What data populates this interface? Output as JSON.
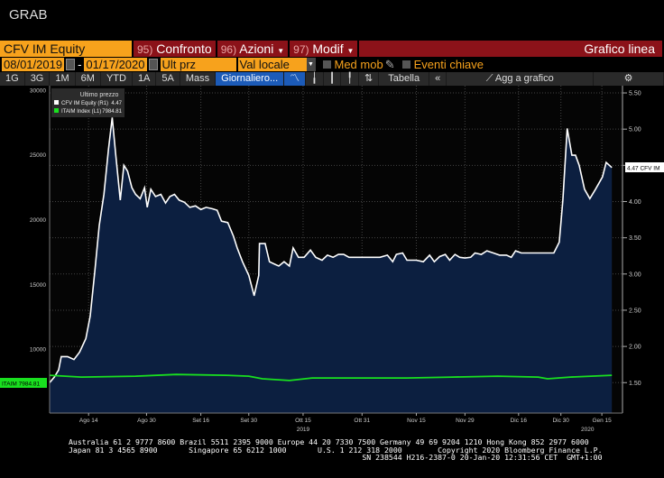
{
  "title": "GRAB",
  "toolbar1": {
    "ticker": "CFV IM Equity",
    "compare_num": "95)",
    "compare": "Confronto",
    "actions_num": "96)",
    "actions": "Azioni",
    "edit_num": "97)",
    "edit": "Modif",
    "chart_type": "Grafico linea"
  },
  "toolbar2": {
    "start_date": "08/01/2019",
    "dash": "-",
    "end_date": "01/17/2020",
    "price_field": "Ult prz",
    "currency": "Val locale",
    "moving_avg": "Med mob",
    "key_events": "Eventi chiave"
  },
  "toolbar3": {
    "periods": [
      "1G",
      "3G",
      "1M",
      "6M",
      "YTD",
      "1A",
      "5A",
      "Mass"
    ],
    "frequency": "Giornaliero...",
    "table": "Tabella",
    "add_to_chart": "Agg a grafico"
  },
  "legend": {
    "title": "Ultimo prezzo",
    "items": [
      {
        "label": "CFV IM Equity",
        "axis": "(R1)",
        "value": "4.47",
        "color": "#ffffff"
      },
      {
        "label": "ITAIM Index",
        "axis": "(L1)",
        "value": "7984.81",
        "color": "#00e000"
      }
    ]
  },
  "last_labels": {
    "cfv": "4.47 CFV IM",
    "itaim": "ITAIM 7984.81"
  },
  "chart_data": {
    "type": "line",
    "x_unit": "days since 2019-08-01",
    "x_range": [
      0,
      172
    ],
    "left_axis": {
      "ticks": [
        "30000",
        "25000",
        "20000",
        "15000",
        "10000"
      ],
      "tick_values": [
        30000,
        25000,
        20000,
        15000,
        10000
      ],
      "ylim": [
        5070,
        30340
      ]
    },
    "right_axis": {
      "ticks": [
        "5.50",
        "5.00",
        "4.50",
        "4.00",
        "3.50",
        "3.00",
        "2.50",
        "2.00",
        "1.50"
      ],
      "tick_values": [
        5.5,
        5.0,
        4.5,
        4.0,
        3.5,
        3.0,
        2.5,
        2.0,
        1.5
      ],
      "ylim": [
        1.08,
        5.6
      ]
    },
    "x_ticks": [
      {
        "label": "Ago 14",
        "day": 11.7
      },
      {
        "label": "Ago 30",
        "day": 29.1
      },
      {
        "label": "Set 16",
        "day": 45.4
      },
      {
        "label": "Set 30",
        "day": 59.8
      },
      {
        "label": "Ott 15",
        "day": 76.1
      },
      {
        "label": "Ott 31",
        "day": 93.8
      },
      {
        "label": "Nov 15",
        "day": 110.1
      },
      {
        "label": "Nov 29",
        "day": 124.7
      },
      {
        "label": "Dic 16",
        "day": 140.8
      },
      {
        "label": "Dic 30",
        "day": 153.5
      },
      {
        "label": "Gen 15",
        "day": 165.8
      }
    ],
    "year_labels": [
      {
        "label": "2019",
        "day": 76.1
      },
      {
        "label": "2020",
        "day": 161.5
      }
    ],
    "series": [
      {
        "name": "CFV IM Equity",
        "axis": "right",
        "color": "#ffffff",
        "x": [
          0,
          1.4,
          2.7,
          3.5,
          5.4,
          7.3,
          9.0,
          10.9,
          12.2,
          13.6,
          14.9,
          16.3,
          17.7,
          18.8,
          19.8,
          21.2,
          22.3,
          23.4,
          24.7,
          25.8,
          27.2,
          28.5,
          29.3,
          30.4,
          31.8,
          33.4,
          34.8,
          36.1,
          37.5,
          38.9,
          40.5,
          42.1,
          43.8,
          45.4,
          47.0,
          48.9,
          50.3,
          51.6,
          53.5,
          55.2,
          56.3,
          57.9,
          59.8,
          61.4,
          62.8,
          63.0,
          64.7,
          66.0,
          67.4,
          68.8,
          70.4,
          72.0,
          73.1,
          74.7,
          76.4,
          78.3,
          79.9,
          81.8,
          83.4,
          85.1,
          86.7,
          88.3,
          89.9,
          91.6,
          93.8,
          96.5,
          99.2,
          101.4,
          103.0,
          104.1,
          106.0,
          107.3,
          110.1,
          112.2,
          114.1,
          115.5,
          117.1,
          118.8,
          120.1,
          121.7,
          123.1,
          124.7,
          126.4,
          127.7,
          129.6,
          131.3,
          133.2,
          135.1,
          137.2,
          138.6,
          139.9,
          141.6,
          143.2,
          145.4,
          148.1,
          151.4,
          153.0,
          154.1,
          155.4,
          156.8,
          157.9,
          159.0,
          160.6,
          162.2,
          163.9,
          166.0,
          167.1,
          168.8
        ],
        "values": [
          1.5,
          1.575,
          1.675,
          1.86,
          1.86,
          1.82,
          1.92,
          2.11,
          2.42,
          3.05,
          3.67,
          4.1,
          4.73,
          5.16,
          4.67,
          4.02,
          4.5,
          4.42,
          4.19,
          4.1,
          4.04,
          4.19,
          3.92,
          4.17,
          4.07,
          4.1,
          3.98,
          4.07,
          4.1,
          4.02,
          3.99,
          3.92,
          3.94,
          3.89,
          3.92,
          3.9,
          3.88,
          3.73,
          3.71,
          3.52,
          3.36,
          3.17,
          2.98,
          2.7,
          2.98,
          3.42,
          3.42,
          3.17,
          3.14,
          3.11,
          3.17,
          3.11,
          3.36,
          3.23,
          3.23,
          3.33,
          3.23,
          3.19,
          3.26,
          3.23,
          3.27,
          3.27,
          3.23,
          3.23,
          3.23,
          3.23,
          3.23,
          3.26,
          3.17,
          3.27,
          3.29,
          3.19,
          3.19,
          3.17,
          3.26,
          3.17,
          3.24,
          3.27,
          3.19,
          3.27,
          3.23,
          3.22,
          3.23,
          3.29,
          3.27,
          3.32,
          3.29,
          3.26,
          3.26,
          3.23,
          3.32,
          3.29,
          3.29,
          3.29,
          3.29,
          3.29,
          3.44,
          4.02,
          5.01,
          4.64,
          4.64,
          4.5,
          4.17,
          4.04,
          4.17,
          4.34,
          4.54,
          4.47
        ]
      },
      {
        "name": "ITAIM Index",
        "axis": "left",
        "color": "#19e01f",
        "x": [
          0,
          9.5,
          25.8,
          38,
          52.9,
          59.8,
          63.9,
          72,
          78.8,
          93.8,
          107.3,
          120.9,
          134.5,
          146.7,
          149.5,
          156.3,
          168.8
        ],
        "values": [
          7985,
          7850,
          7920,
          8050,
          7985,
          7920,
          7715,
          7580,
          7780,
          7780,
          7780,
          7850,
          7920,
          7850,
          7715,
          7850,
          7985
        ]
      }
    ]
  },
  "footer": {
    "line1": "Australia 61 2 9777 8600 Brazil 5511 2395 9000 Europe 44 20 7330 7500 Germany 49 69 9204 1210 Hong Kong 852 2977 6000",
    "line2": "Japan 81 3 4565 8900       Singapore 65 6212 1000       U.S. 1 212 318 2000        Copyright 2020 Bloomberg Finance L.P.",
    "line3": "SN 238544 H216-2387-0 20-Jan-20 12:31:56 CET  GMT+1:00"
  }
}
